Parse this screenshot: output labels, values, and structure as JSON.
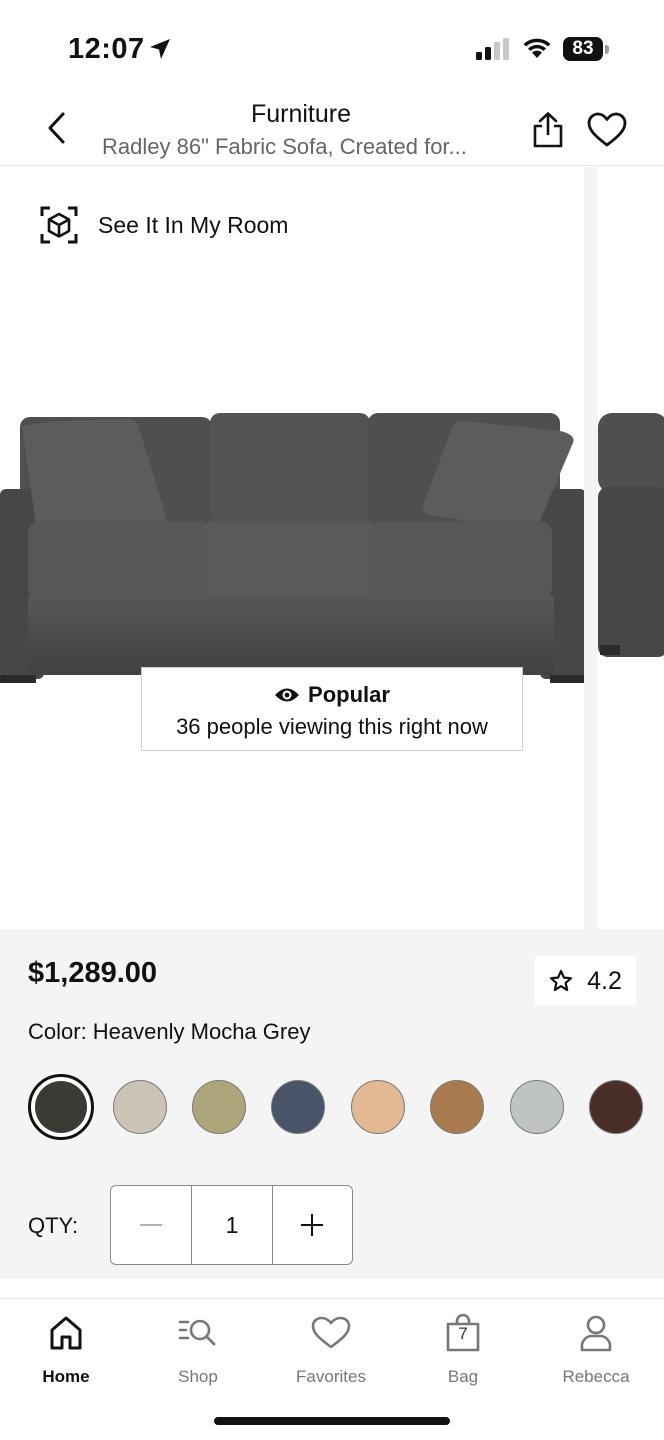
{
  "status_bar": {
    "time": "12:07",
    "battery": "83"
  },
  "header": {
    "title": "Furniture",
    "subtitle": "Radley 86\" Fabric Sofa, Created for..."
  },
  "gallery": {
    "ar_label": "See It In My Room",
    "popular": {
      "title": "Popular",
      "text": "36 people viewing this right now"
    }
  },
  "product": {
    "price": "$1,289.00",
    "rating": "4.2",
    "color_label": "Color: Heavenly Mocha Grey",
    "swatches": [
      "#3a3b35",
      "#cbc4b5",
      "#aea67a",
      "#4a5468",
      "#e2b993",
      "#a97a4d",
      "#bfc3c4",
      "#4a2e28"
    ],
    "qty_label": "QTY:",
    "qty_value": "1",
    "qty_minus": "−",
    "qty_plus": "+"
  },
  "tabs": [
    {
      "label": "Home",
      "icon": "home-icon",
      "active": true
    },
    {
      "label": "Shop",
      "icon": "search-list-icon"
    },
    {
      "label": "Favorites",
      "icon": "heart-icon"
    },
    {
      "label": "Bag",
      "icon": "bag-icon",
      "badge": "7"
    },
    {
      "label": "Rebecca",
      "icon": "person-icon"
    }
  ],
  "colors": {
    "accent": "#111111",
    "panel": "#f4f4f4",
    "sofa": "#4e4e4c"
  }
}
